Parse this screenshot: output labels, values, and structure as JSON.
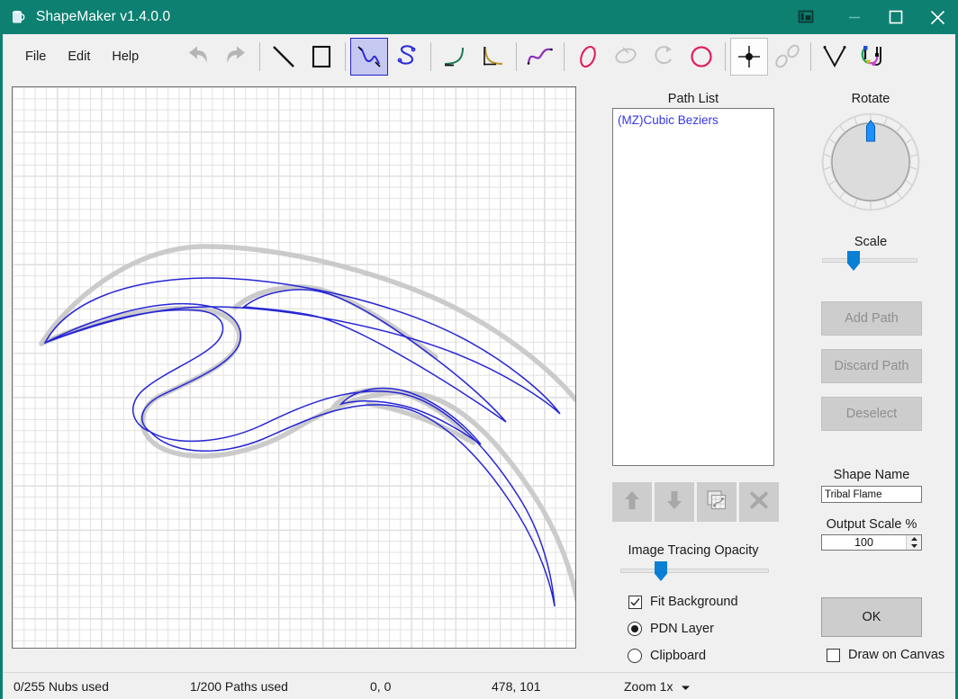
{
  "window": {
    "title": "ShapeMaker v1.4.0.0",
    "app_icon": "cup-icon",
    "titlebar_color": "#0d8072",
    "controls": {
      "screenshot_label": "screenshot-icon",
      "minimize_label": "minimize-icon",
      "maximize_label": "maximize-icon",
      "close_label": "close-icon"
    }
  },
  "menu": {
    "items": [
      {
        "label": "File",
        "name": "menu-file"
      },
      {
        "label": "Edit",
        "name": "menu-edit"
      },
      {
        "label": "Help",
        "name": "menu-help"
      }
    ]
  },
  "toolbar": {
    "tools": [
      {
        "name": "undo-icon",
        "title": "Undo",
        "state": "disabled"
      },
      {
        "name": "redo-icon",
        "title": "Redo",
        "state": "disabled"
      },
      {
        "name": "line-tool-icon",
        "title": "Line",
        "state": "normal"
      },
      {
        "name": "rectangle-tool-icon",
        "title": "Rectangle",
        "state": "normal"
      },
      {
        "name": "cubic-bezier-tool-icon",
        "title": "Cubic Beziers",
        "state": "selected"
      },
      {
        "name": "s-curve-tool-icon",
        "title": "S Curve",
        "state": "normal"
      },
      {
        "name": "concave-curve-tool-icon",
        "title": "Concave Curve",
        "state": "normal"
      },
      {
        "name": "corner-curve-tool-icon",
        "title": "Corner Curve",
        "state": "normal"
      },
      {
        "name": "wave-tool-icon",
        "title": "Wave",
        "state": "normal"
      },
      {
        "name": "ellipse-tool-icon",
        "title": "Ellipse",
        "state": "normal"
      },
      {
        "name": "ellipse-alt-tool-icon",
        "title": "Ellipse Alt",
        "state": "disabled"
      },
      {
        "name": "arc-tool-icon",
        "title": "Arc",
        "state": "disabled"
      },
      {
        "name": "circle-tool-icon",
        "title": "Circle",
        "state": "normal"
      },
      {
        "name": "nub-move-tool-icon",
        "title": "Move Nub",
        "state": "boxed"
      },
      {
        "name": "double-ellipse-icon",
        "title": "Double Ellipse",
        "state": "disabled"
      },
      {
        "name": "vee-tool-icon",
        "title": "Vee",
        "state": "normal"
      },
      {
        "name": "path-edit-tool-icon",
        "title": "Path Edit",
        "state": "normal"
      }
    ]
  },
  "canvas": {
    "name": "drawing-canvas",
    "grid_minor_color": "#e2e2e2",
    "grid_major_color": "#a6a6a6",
    "stroke_color": "#2626d6",
    "trace_color": "#c8c8c8",
    "shape_description": "Tribal flame outline"
  },
  "path_panel": {
    "title": "Path List",
    "items": [
      {
        "label": "(MZ)Cubic Beziers"
      }
    ],
    "buttons": [
      {
        "name": "move-path-up-button",
        "icon": "arrow-up-icon"
      },
      {
        "name": "move-path-down-button",
        "icon": "arrow-down-icon"
      },
      {
        "name": "duplicate-path-button",
        "icon": "copy-path-icon"
      },
      {
        "name": "delete-path-button",
        "icon": "cross-icon"
      }
    ],
    "opacity_label": "Image Tracing Opacity",
    "opacity_value": 24,
    "options": {
      "fit_background": {
        "label": "Fit Background",
        "checked": true
      },
      "source": {
        "selected": "PDN Layer",
        "choices": [
          {
            "label": "PDN Layer",
            "checked": true
          },
          {
            "label": "Clipboard",
            "checked": false
          }
        ]
      }
    }
  },
  "transform_panel": {
    "rotate_label": "Rotate",
    "rotate_value": 0,
    "scale_label": "Scale",
    "scale_value": 27,
    "buttons": [
      {
        "label": "Add Path",
        "enabled": false
      },
      {
        "label": "Discard Path",
        "enabled": false
      },
      {
        "label": "Deselect",
        "enabled": false
      }
    ],
    "shape_name_label": "Shape Name",
    "shape_name_value": "Tribal Flame",
    "output_scale_label": "Output Scale %",
    "output_scale_value": "100",
    "ok_label": "OK",
    "draw_on_canvas": {
      "label": "Draw on Canvas",
      "checked": false
    }
  },
  "statusbar": {
    "nubs": "0/255 Nubs used",
    "paths": "1/200 Paths used",
    "origin": "0, 0",
    "cursor": "478, 101",
    "zoom": "Zoom 1x"
  }
}
